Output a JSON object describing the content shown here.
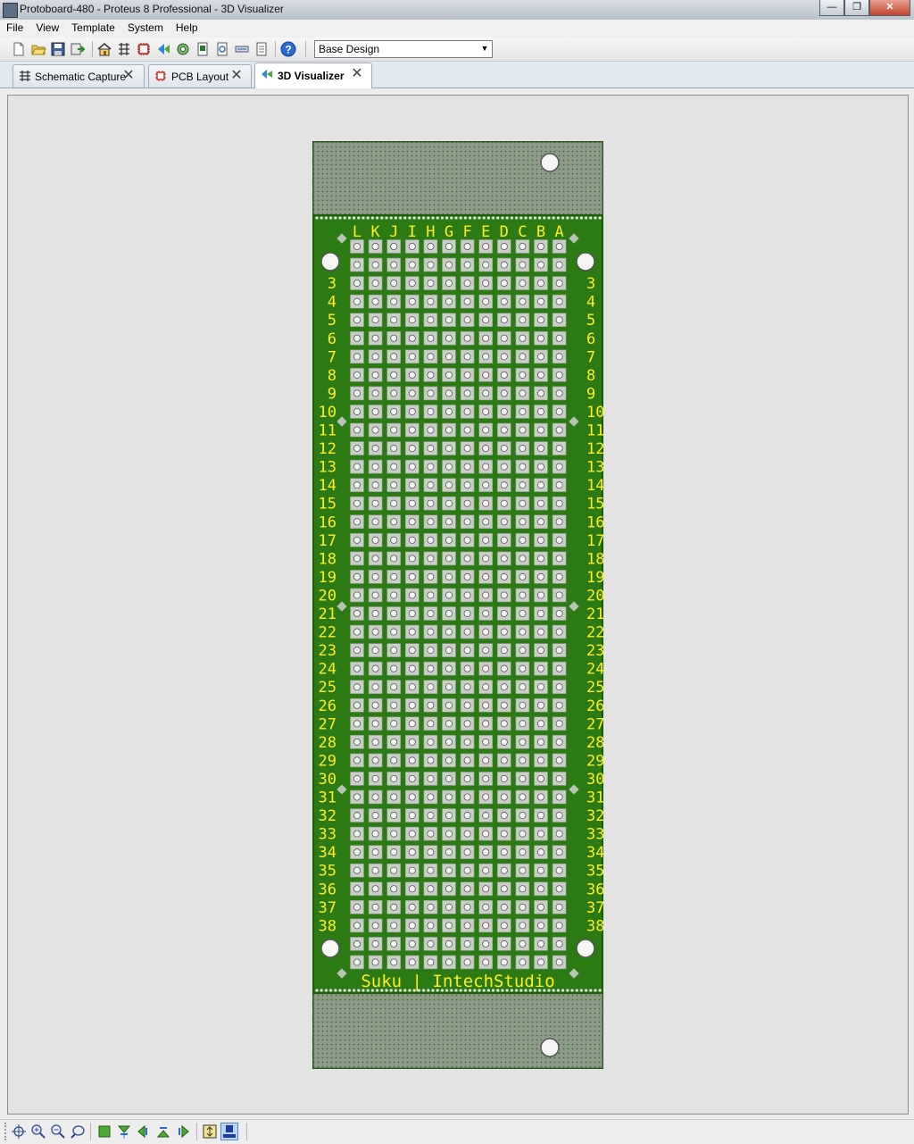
{
  "window": {
    "title": "Protoboard-480 - Proteus 8 Professional - 3D Visualizer",
    "minimize_glyph": "—",
    "restore_glyph": "❐",
    "close_glyph": "✕"
  },
  "menu": [
    {
      "label": "File"
    },
    {
      "label": "View"
    },
    {
      "label": "Template"
    },
    {
      "label": "System"
    },
    {
      "label": "Help"
    }
  ],
  "toolbar": {
    "buttons": [
      "new-file-icon",
      "open-folder-icon",
      "save-icon",
      "import-icon",
      "home-icon",
      "schematic-icon",
      "pcb-chip-icon",
      "visualizer-icon",
      "gerber-icon",
      "bom-icon",
      "design-explorer-icon",
      "project-notes-icon",
      "report-icon",
      "help-icon"
    ],
    "design_select": {
      "value": "Base Design",
      "arrow": "▼"
    }
  },
  "tabs": [
    {
      "label": "Schematic Capture",
      "icon": "schematic-icon",
      "active": false,
      "close": "✕"
    },
    {
      "label": "PCB Layout",
      "icon": "pcb-chip-icon",
      "active": false,
      "close": "✕"
    },
    {
      "label": "3D Visualizer",
      "icon": "visualizer-icon",
      "active": true,
      "close": "✕"
    }
  ],
  "board": {
    "column_labels": [
      "L",
      "K",
      "J",
      "I",
      "H",
      "G",
      "F",
      "E",
      "D",
      "C",
      "B",
      "A"
    ],
    "row_labels": [
      "3",
      "4",
      "5",
      "6",
      "7",
      "8",
      "9",
      "10",
      "11",
      "12",
      "13",
      "14",
      "15",
      "16",
      "17",
      "18",
      "19",
      "20",
      "21",
      "22",
      "23",
      "24",
      "25",
      "26",
      "27",
      "28",
      "29",
      "30",
      "31",
      "32",
      "33",
      "34",
      "35",
      "36",
      "37",
      "38"
    ],
    "hole_rows": 40,
    "hole_cols": 12,
    "footer_text": "Suku | IntechStudio",
    "colors": {
      "pcb": "#2b7a14",
      "pcb_dark": "#1e5c0b",
      "pad": "#c9cfc7",
      "label": "#ffee22",
      "end_panel": "#8e9e8a"
    }
  },
  "statusbar": {
    "buttons": [
      "pan-icon",
      "zoom-in-icon",
      "zoom-out-icon",
      "zoom-fit-icon",
      "view-top-icon",
      "view-down-icon",
      "view-left-icon",
      "view-up-icon",
      "view-right-icon",
      "height-icon",
      "board-view-icon"
    ]
  }
}
